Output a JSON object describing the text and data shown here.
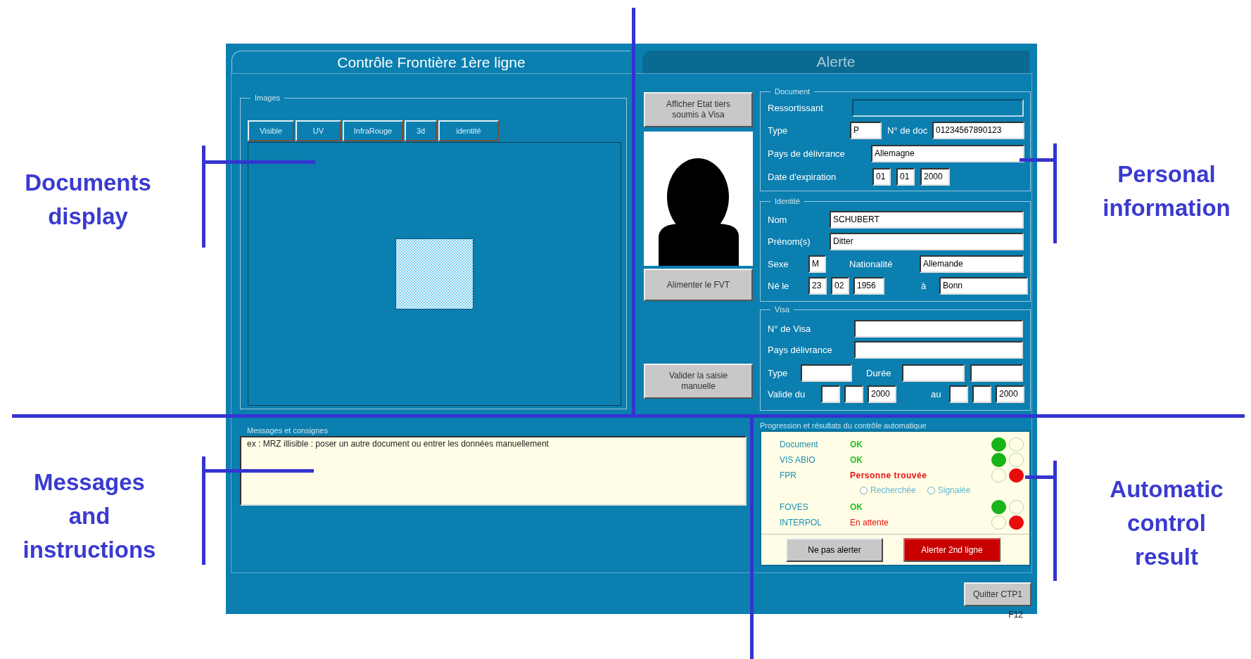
{
  "window": {
    "tabs": [
      {
        "label": "Contrôle Frontière 1ère ligne",
        "selected": true
      },
      {
        "label": "Alerte",
        "selected": false
      }
    ]
  },
  "images": {
    "legend": "Images",
    "tabs": [
      {
        "label": "Visible",
        "selected": false
      },
      {
        "label": "UV",
        "selected": false
      },
      {
        "label": "InfraRouge",
        "selected": false
      },
      {
        "label": "3d",
        "selected": false
      },
      {
        "label": "identité",
        "selected": false
      }
    ]
  },
  "side_buttons": [
    {
      "lines": [
        "Afficher Etat tiers",
        "soumis à Visa"
      ]
    },
    {
      "lines": [
        "Alimenter le FVT"
      ]
    },
    {
      "lines": [
        "Valider la saisie",
        "manuelle"
      ]
    }
  ],
  "document": {
    "legend": "Document",
    "fields": [
      {
        "label": "Ressortissant",
        "disabled": true
      },
      {
        "label": "Type",
        "value": "P",
        "disabled": false
      },
      {
        "label": "N° de doc",
        "value": "01234567890123",
        "disabled": false
      },
      {
        "label": "Pays de délivrance",
        "value": "Allemagne",
        "disabled": false
      },
      {
        "label": "Date d'expiration",
        "values": [
          "01",
          "01",
          "2000"
        ],
        "disabled": false
      }
    ]
  },
  "identite": {
    "legend": "Identité",
    "nom": {
      "label": "Nom",
      "value": "SCHUBERT"
    },
    "prenom": {
      "label": "Prénom(s)",
      "value": "Ditter"
    },
    "sexe": {
      "label": "Sexe",
      "value": "M"
    },
    "nationalite": {
      "label": "Nationalité",
      "value": "Allemande"
    },
    "ne_le": {
      "label": "Né le",
      "values": [
        "23",
        "02",
        "1956"
      ]
    },
    "lieu": {
      "label": "à",
      "value": "Bonn"
    }
  },
  "visa": {
    "legend": "Visa",
    "numero": {
      "label": "N° de Visa"
    },
    "pays": {
      "label": "Pays délivrance"
    },
    "type": {
      "label": "Type"
    },
    "duree": {
      "label": "Durée"
    },
    "valide_du": {
      "label": "Valide du",
      "values": [
        "2000"
      ]
    },
    "au": {
      "label": "au",
      "values": [
        "2000"
      ]
    }
  },
  "progress": {
    "legend": "Progression et résultats du contrôle automatique",
    "rows": [
      {
        "label": "Document",
        "result": "OK",
        "kind": "ok",
        "green_on": true,
        "red_on": false
      },
      {
        "label": "VIS ABIO",
        "result": "OK",
        "kind": "ok",
        "green_on": true,
        "red_on": false
      },
      {
        "label": "FPR",
        "result": "Personne trouvée",
        "kind": "found",
        "green_on": false,
        "red_on": true,
        "options": [
          {
            "label": "Recherchée",
            "selected": false
          },
          {
            "label": "Signalée",
            "selected": false
          }
        ]
      },
      {
        "label": "FOVES",
        "result": "OK",
        "kind": "ok",
        "green_on": true,
        "red_on": false
      },
      {
        "label": "INTERPOL",
        "result": "En attente",
        "kind": "pending",
        "green_on": false,
        "red_on": true
      }
    ],
    "buttons": [
      {
        "label": "Ne pas alerter",
        "kind": "neutral"
      },
      {
        "label": "Alerter 2nd ligne",
        "kind": "alert"
      }
    ]
  },
  "messages": {
    "legend": "Messages et consignes",
    "text": "ex : MRZ illisible : poser un autre document ou entrer les données manuellement"
  },
  "quit": {
    "label": "Quitter CTP1",
    "shortcut": "F12"
  },
  "annotations": [
    {
      "lines": [
        "Documents",
        "display"
      ]
    },
    {
      "lines": [
        "Personal",
        "information"
      ]
    },
    {
      "lines": [
        "Messages",
        "and",
        "instructions"
      ]
    },
    {
      "lines": [
        "Automatic",
        "control",
        "result"
      ]
    }
  ]
}
